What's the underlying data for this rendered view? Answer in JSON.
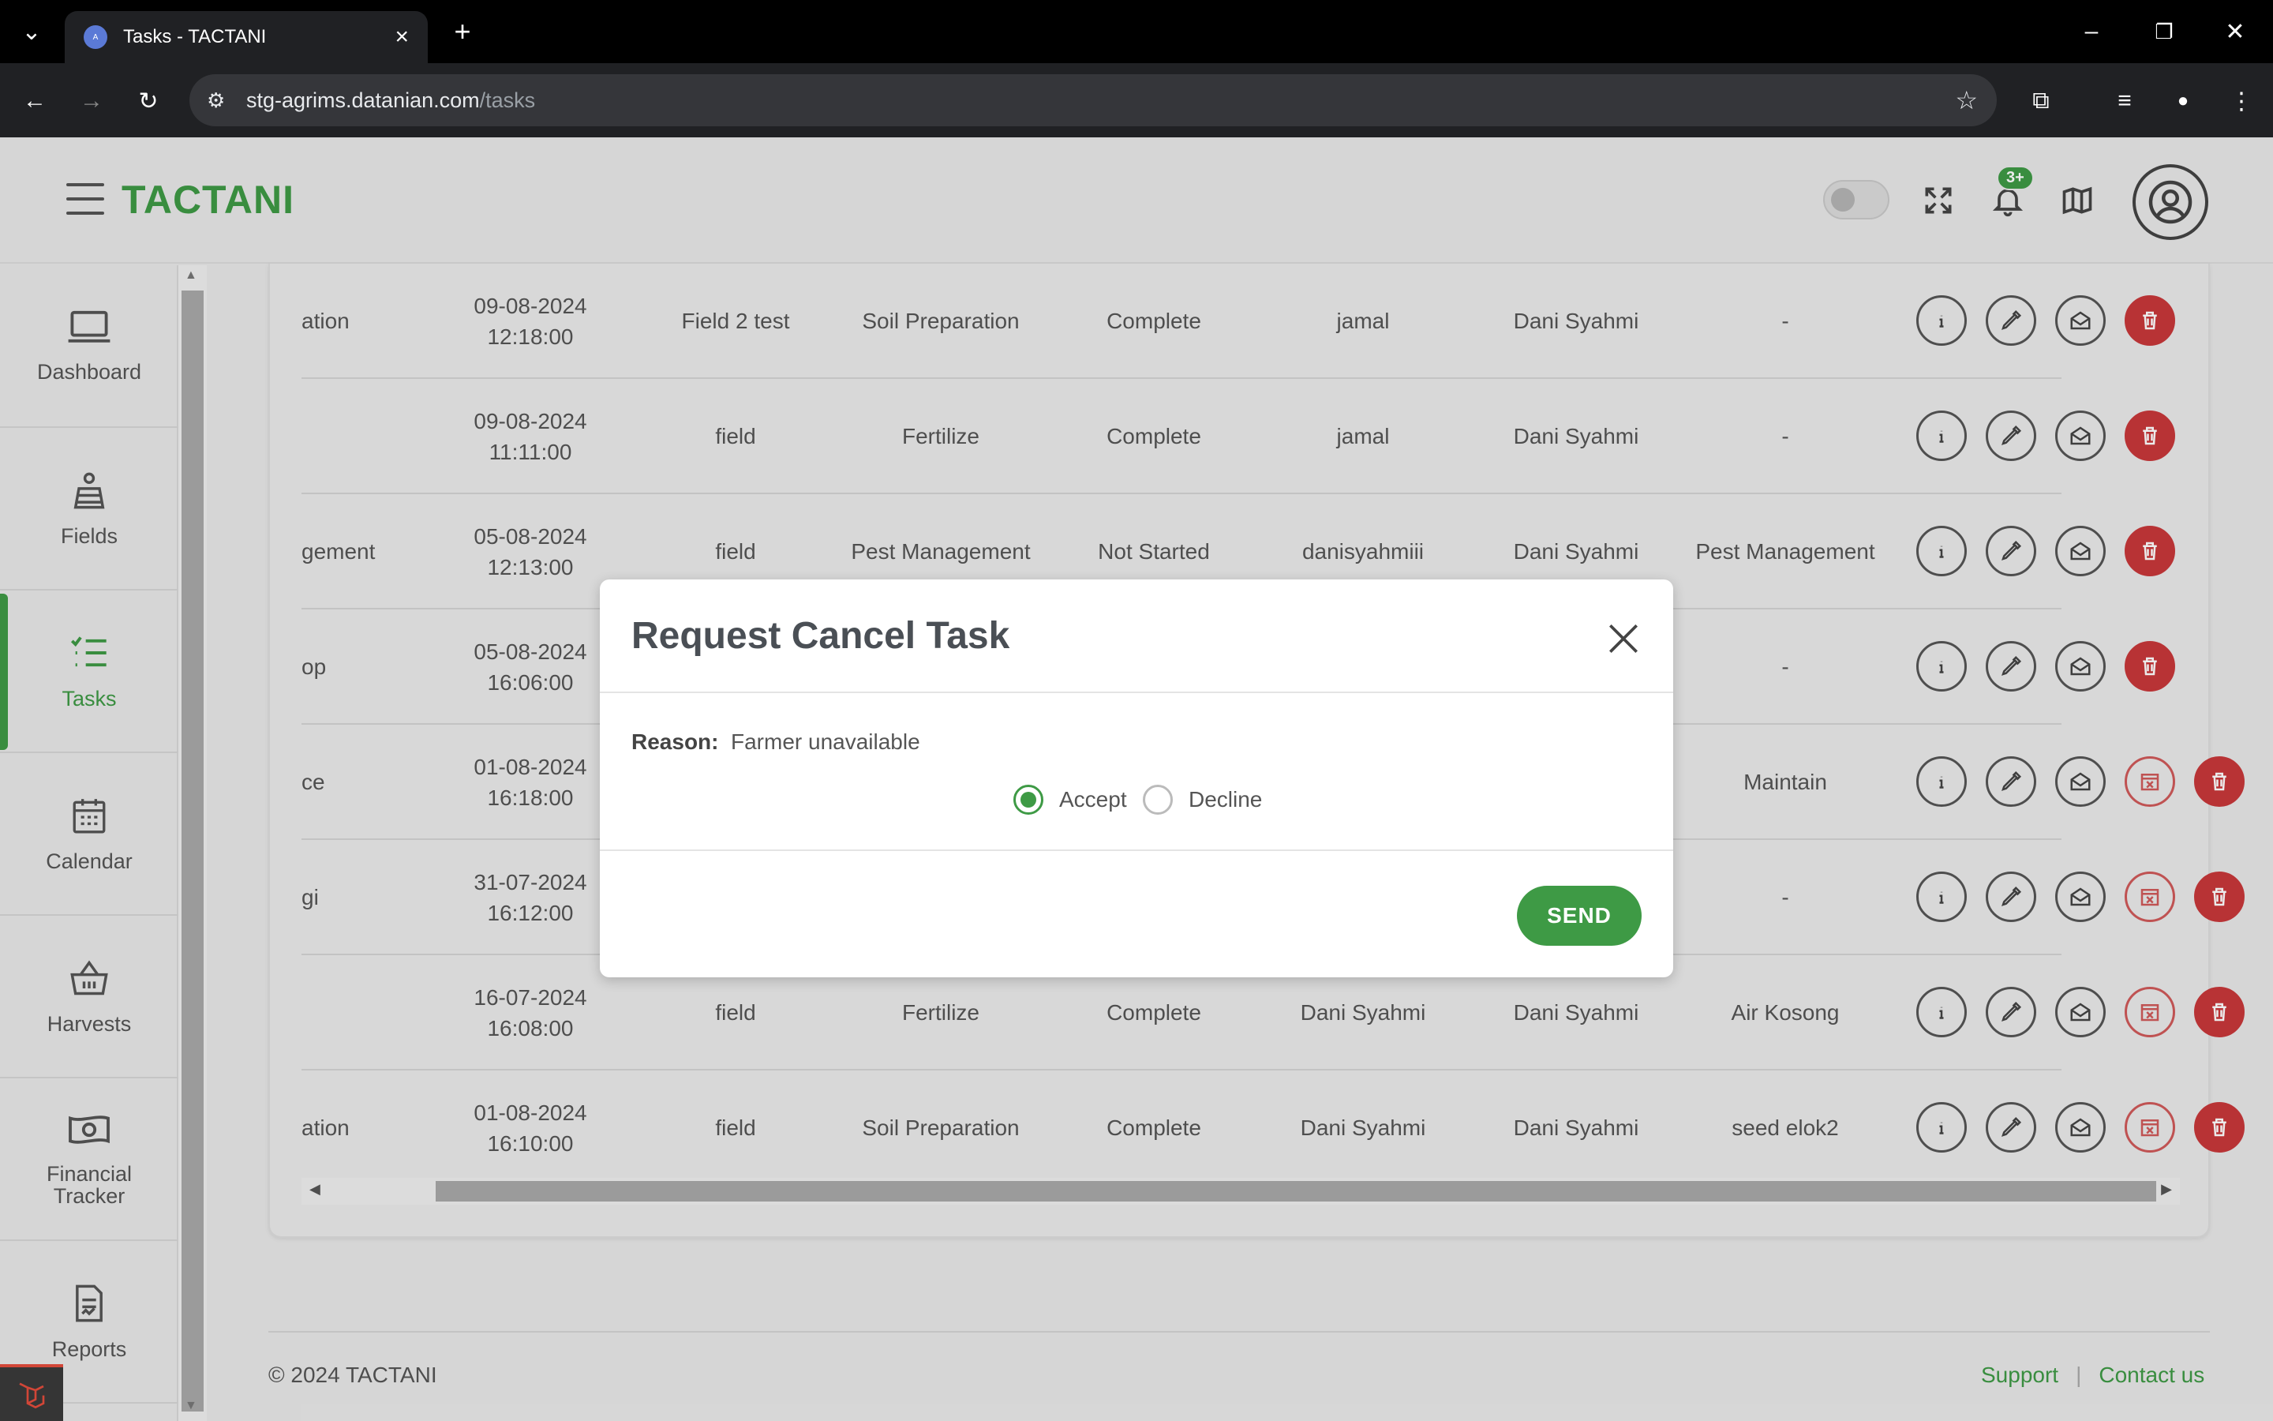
{
  "browser": {
    "tab_title": "Tasks - TACTANI",
    "url_host": "stg-agrims.datanian.com",
    "url_path": "/tasks"
  },
  "header": {
    "brand": "TACTANI",
    "notification_count": "3+"
  },
  "sidebar": {
    "items": [
      {
        "label": "Dashboard",
        "icon": "laptop-icon"
      },
      {
        "label": "Fields",
        "icon": "field-icon"
      },
      {
        "label": "Tasks",
        "icon": "checklist-icon",
        "active": true
      },
      {
        "label": "Calendar",
        "icon": "calendar-icon"
      },
      {
        "label": "Harvests",
        "icon": "basket-icon"
      },
      {
        "label": "Financial Tracker",
        "icon": "money-icon"
      },
      {
        "label": "Reports",
        "icon": "report-icon"
      }
    ]
  },
  "table": {
    "rows": [
      {
        "name": "ation",
        "date": "09-08-2024",
        "time": "12:18:00",
        "field": "Field 2 test",
        "type": "Soil Preparation",
        "status": "Complete",
        "assignee": "jamal",
        "creator": "Dani Syahmi",
        "note": "-",
        "cancel": false
      },
      {
        "name": "",
        "date": "09-08-2024",
        "time": "11:11:00",
        "field": "field",
        "type": "Fertilize",
        "status": "Complete",
        "assignee": "jamal",
        "creator": "Dani Syahmi",
        "note": "-",
        "cancel": false
      },
      {
        "name": "gement",
        "date": "05-08-2024",
        "time": "12:13:00",
        "field": "field",
        "type": "Pest Management",
        "status": "Not Started",
        "assignee": "danisyahmiii",
        "creator": "Dani Syahmi",
        "note": "Pest Management",
        "cancel": false
      },
      {
        "name": "op",
        "date": "05-08-2024",
        "time": "16:06:00",
        "field": "",
        "type": "",
        "status": "",
        "assignee": "",
        "creator": "",
        "note": "-",
        "cancel": false
      },
      {
        "name": "ce",
        "date": "01-08-2024",
        "time": "16:18:00",
        "field": "",
        "type": "",
        "status": "",
        "assignee": "",
        "creator": "",
        "note": "Maintain",
        "cancel": true
      },
      {
        "name": "gi",
        "date": "31-07-2024",
        "time": "16:12:00",
        "field": "",
        "type": "",
        "status": "",
        "assignee": "",
        "creator": "",
        "note": "-",
        "cancel": true
      },
      {
        "name": "",
        "date": "16-07-2024",
        "time": "16:08:00",
        "field": "field",
        "type": "Fertilize",
        "status": "Complete",
        "assignee": "Dani Syahmi",
        "creator": "Dani Syahmi",
        "note": "Air Kosong",
        "cancel": true
      },
      {
        "name": "ation",
        "date": "01-08-2024",
        "time": "16:10:00",
        "field": "field",
        "type": "Soil Preparation",
        "status": "Complete",
        "assignee": "Dani Syahmi",
        "creator": "Dani Syahmi",
        "note": "seed elok2",
        "cancel": true
      }
    ]
  },
  "modal": {
    "title": "Request Cancel Task",
    "reason_label": "Reason:",
    "reason_value": "Farmer unavailable",
    "option_accept": "Accept",
    "option_decline": "Decline",
    "selected": "Accept",
    "send_label": "SEND"
  },
  "footer": {
    "copyright": "© 2024 TACTANI",
    "support": "Support",
    "contact": "Contact us"
  },
  "colors": {
    "brand": "#3e9a45",
    "danger": "#c8383a"
  }
}
